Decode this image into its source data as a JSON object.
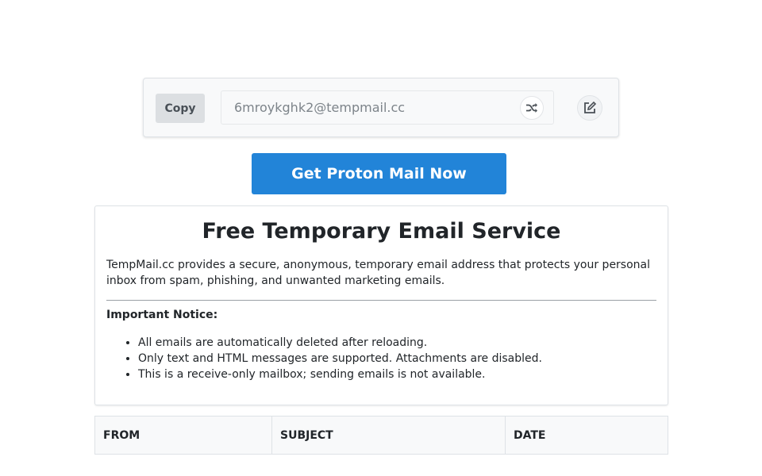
{
  "email_bar": {
    "copy_label": "Copy",
    "email_address": "6mroykghk2@tempmail.cc",
    "shuffle_icon": "shuffle-icon",
    "edit_icon": "edit-icon"
  },
  "promo": {
    "label": "Get Proton Mail Now",
    "color": "#2284d8"
  },
  "info": {
    "title": "Free Temporary Email Service",
    "description": "TempMail.cc provides a secure, anonymous, temporary email address that protects your personal inbox from spam, phishing, and unwanted marketing emails.",
    "notice_title": "Important Notice:",
    "notices": [
      "All emails are automatically deleted after reloading.",
      "Only text and HTML messages are supported. Attachments are disabled.",
      "This is a receive-only mailbox; sending emails is not available."
    ]
  },
  "table": {
    "columns": [
      "FROM",
      "SUBJECT",
      "DATE"
    ]
  }
}
